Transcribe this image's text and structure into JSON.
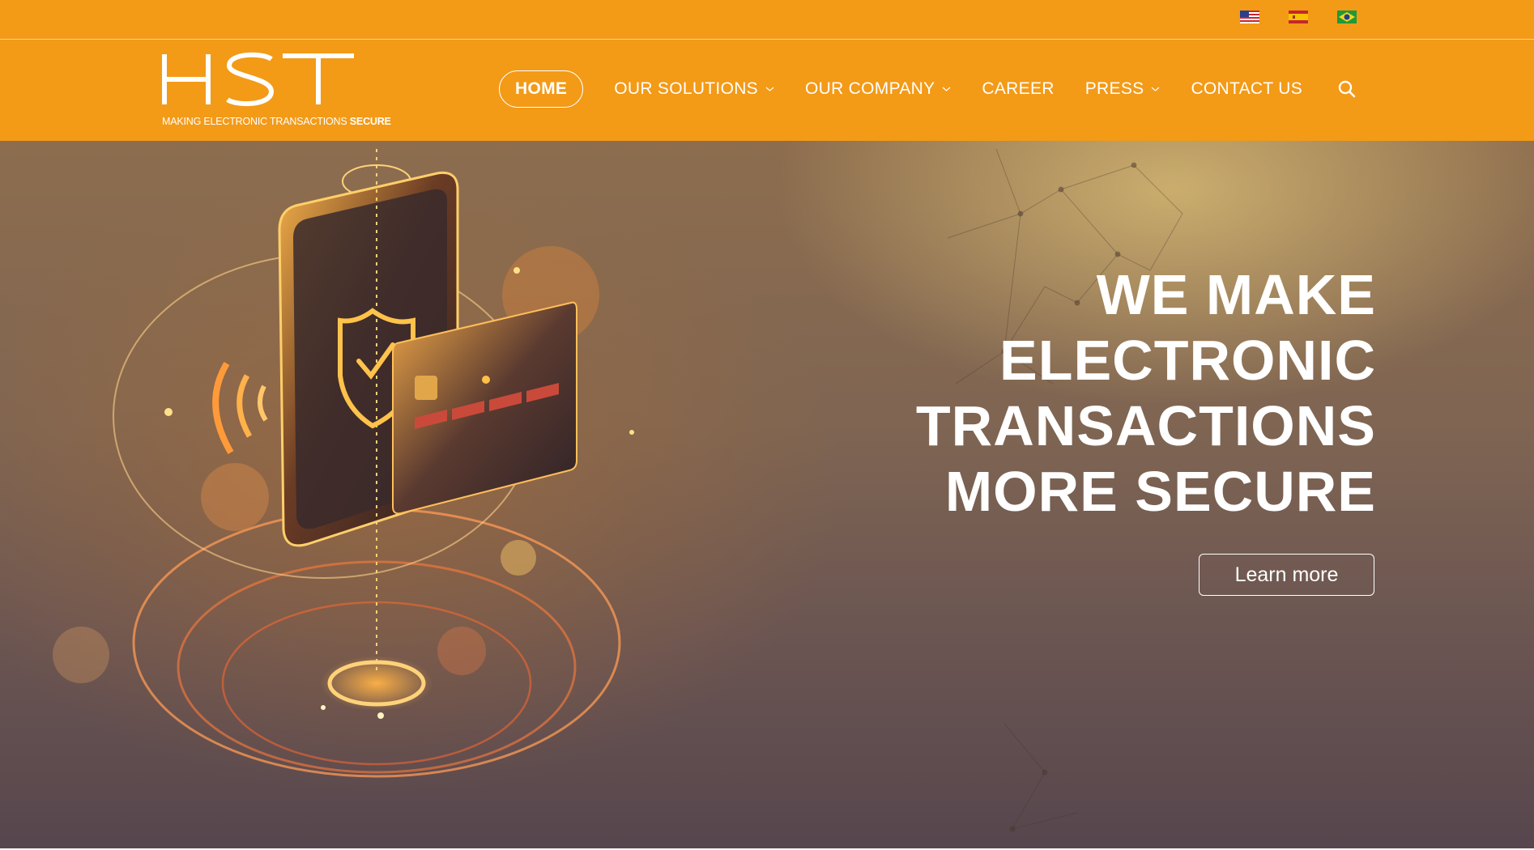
{
  "languages": [
    {
      "icon": "us-flag-icon"
    },
    {
      "icon": "es-flag-icon"
    },
    {
      "icon": "br-flag-icon"
    }
  ],
  "logo": {
    "mark": "HST",
    "tagline_regular": "MAKING ELECTRONIC TRANSACTIONS ",
    "tagline_bold": "SECURE"
  },
  "nav": {
    "home": "HOME",
    "solutions": "OUR SOLUTIONS",
    "company": "OUR COMPANY",
    "career": "CAREER",
    "press": "PRESS",
    "contact": "CONTACT US",
    "search_icon": "search-icon"
  },
  "hero": {
    "title_lines": [
      "WE MAKE",
      "ELECTRONIC",
      "TRANSACTIONS",
      "MORE SECURE"
    ],
    "cta": "Learn more"
  },
  "colors": {
    "brand_orange": "#f39a17",
    "text_white": "#ffffff"
  }
}
